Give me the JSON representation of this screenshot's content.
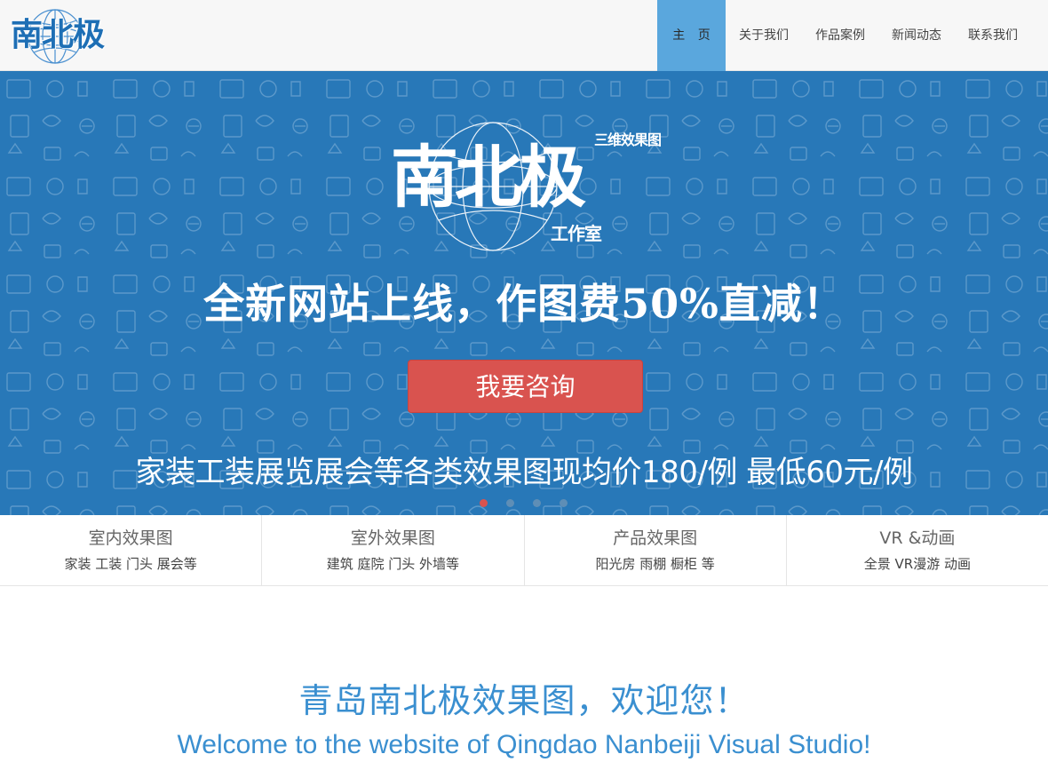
{
  "brand": {
    "logo_text": "南北极",
    "primary_color": "#1e6fb5",
    "banner_color": "#2878b8",
    "accent_color": "#d9534f"
  },
  "nav": {
    "items": [
      {
        "label": "主 页",
        "active": true
      },
      {
        "label": "关于我们",
        "active": false
      },
      {
        "label": "作品案例",
        "active": false
      },
      {
        "label": "新闻动态",
        "active": false
      },
      {
        "label": "联系我们",
        "active": false
      }
    ]
  },
  "banner": {
    "logo_tag_top": "三维效果图",
    "logo_main": "南北极",
    "logo_tag_bottom": "工作室",
    "headline": "全新网站上线，作图费50%直减！",
    "cta_label": "我要咨询",
    "subline": "家装工装展览展会等各类效果图现均价180/例 最低60元/例",
    "slide_count": 4,
    "active_slide": 1
  },
  "categories": [
    {
      "title": "室内效果图",
      "sub": "家装 工装 门头 展会等"
    },
    {
      "title": "室外效果图",
      "sub": "建筑 庭院 门头 外墙等"
    },
    {
      "title": "产品效果图",
      "sub": "阳光房 雨棚 橱柜 等"
    },
    {
      "title": "VR &动画",
      "sub": "全景 VR漫游 动画"
    }
  ],
  "welcome": {
    "cn": "青岛南北极效果图，欢迎您！",
    "en": "Welcome to the website of Qingdao Nanbeiji Visual Studio!"
  }
}
